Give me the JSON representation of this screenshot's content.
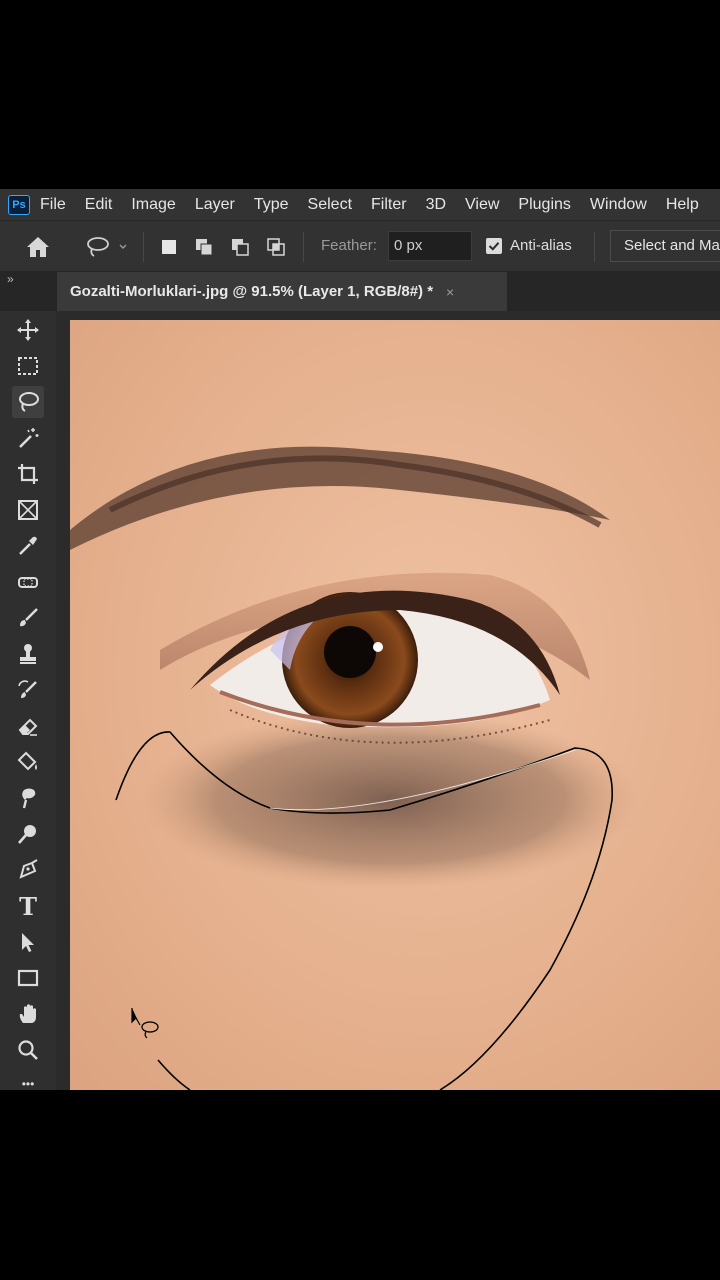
{
  "app": {
    "logo": "Ps",
    "menu": [
      "File",
      "Edit",
      "Image",
      "Layer",
      "Type",
      "Select",
      "Filter",
      "3D",
      "View",
      "Plugins",
      "Window",
      "Help"
    ]
  },
  "options_bar": {
    "feather_label": "Feather:",
    "feather_value": "0 px",
    "anti_alias_label": "Anti-alias",
    "anti_alias_checked": true,
    "select_and_mask_label": "Select and Ma"
  },
  "document": {
    "collapse_icon": "»",
    "tab_title": "Gozalti-Morluklari-.jpg @ 91.5% (Layer 1, RGB/8#) *",
    "close_icon": "×"
  },
  "toolbar": {
    "tools": [
      "move-tool",
      "marquee-tool",
      "lasso-tool",
      "magic-wand-tool",
      "crop-tool",
      "frame-tool",
      "eyedropper-tool",
      "healing-brush-tool",
      "brush-tool",
      "clone-stamp-tool",
      "history-brush-tool",
      "eraser-tool",
      "paint-bucket-tool",
      "smudge-tool",
      "dodge-tool",
      "pen-tool",
      "type-tool",
      "path-selection-tool",
      "rectangle-tool",
      "hand-tool",
      "zoom-tool",
      "more-tools"
    ],
    "active_tool": "lasso-tool",
    "type_tool_glyph": "T",
    "more_glyph": "•••"
  },
  "colors": {
    "accent": "#31a8ff",
    "menubar_bg": "#333333",
    "canvas_skin": "#e8b594"
  }
}
